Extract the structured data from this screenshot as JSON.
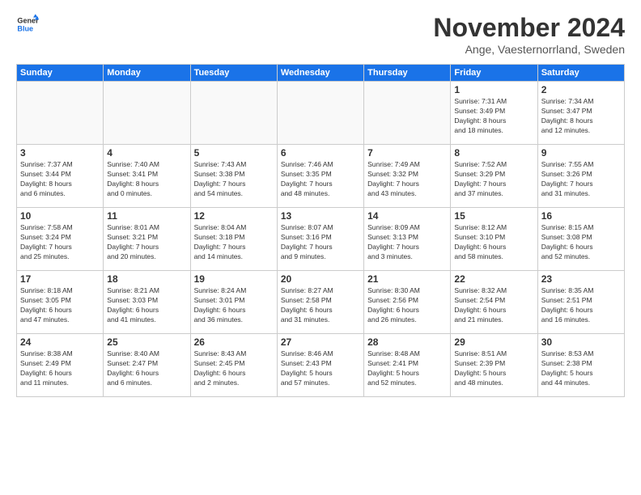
{
  "logo": {
    "text1": "General",
    "text2": "Blue"
  },
  "title": "November 2024",
  "subtitle": "Ange, Vaesternorrland, Sweden",
  "weekdays": [
    "Sunday",
    "Monday",
    "Tuesday",
    "Wednesday",
    "Thursday",
    "Friday",
    "Saturday"
  ],
  "weeks": [
    [
      {
        "day": "",
        "info": ""
      },
      {
        "day": "",
        "info": ""
      },
      {
        "day": "",
        "info": ""
      },
      {
        "day": "",
        "info": ""
      },
      {
        "day": "",
        "info": ""
      },
      {
        "day": "1",
        "info": "Sunrise: 7:31 AM\nSunset: 3:49 PM\nDaylight: 8 hours\nand 18 minutes."
      },
      {
        "day": "2",
        "info": "Sunrise: 7:34 AM\nSunset: 3:47 PM\nDaylight: 8 hours\nand 12 minutes."
      }
    ],
    [
      {
        "day": "3",
        "info": "Sunrise: 7:37 AM\nSunset: 3:44 PM\nDaylight: 8 hours\nand 6 minutes."
      },
      {
        "day": "4",
        "info": "Sunrise: 7:40 AM\nSunset: 3:41 PM\nDaylight: 8 hours\nand 0 minutes."
      },
      {
        "day": "5",
        "info": "Sunrise: 7:43 AM\nSunset: 3:38 PM\nDaylight: 7 hours\nand 54 minutes."
      },
      {
        "day": "6",
        "info": "Sunrise: 7:46 AM\nSunset: 3:35 PM\nDaylight: 7 hours\nand 48 minutes."
      },
      {
        "day": "7",
        "info": "Sunrise: 7:49 AM\nSunset: 3:32 PM\nDaylight: 7 hours\nand 43 minutes."
      },
      {
        "day": "8",
        "info": "Sunrise: 7:52 AM\nSunset: 3:29 PM\nDaylight: 7 hours\nand 37 minutes."
      },
      {
        "day": "9",
        "info": "Sunrise: 7:55 AM\nSunset: 3:26 PM\nDaylight: 7 hours\nand 31 minutes."
      }
    ],
    [
      {
        "day": "10",
        "info": "Sunrise: 7:58 AM\nSunset: 3:24 PM\nDaylight: 7 hours\nand 25 minutes."
      },
      {
        "day": "11",
        "info": "Sunrise: 8:01 AM\nSunset: 3:21 PM\nDaylight: 7 hours\nand 20 minutes."
      },
      {
        "day": "12",
        "info": "Sunrise: 8:04 AM\nSunset: 3:18 PM\nDaylight: 7 hours\nand 14 minutes."
      },
      {
        "day": "13",
        "info": "Sunrise: 8:07 AM\nSunset: 3:16 PM\nDaylight: 7 hours\nand 9 minutes."
      },
      {
        "day": "14",
        "info": "Sunrise: 8:09 AM\nSunset: 3:13 PM\nDaylight: 7 hours\nand 3 minutes."
      },
      {
        "day": "15",
        "info": "Sunrise: 8:12 AM\nSunset: 3:10 PM\nDaylight: 6 hours\nand 58 minutes."
      },
      {
        "day": "16",
        "info": "Sunrise: 8:15 AM\nSunset: 3:08 PM\nDaylight: 6 hours\nand 52 minutes."
      }
    ],
    [
      {
        "day": "17",
        "info": "Sunrise: 8:18 AM\nSunset: 3:05 PM\nDaylight: 6 hours\nand 47 minutes."
      },
      {
        "day": "18",
        "info": "Sunrise: 8:21 AM\nSunset: 3:03 PM\nDaylight: 6 hours\nand 41 minutes."
      },
      {
        "day": "19",
        "info": "Sunrise: 8:24 AM\nSunset: 3:01 PM\nDaylight: 6 hours\nand 36 minutes."
      },
      {
        "day": "20",
        "info": "Sunrise: 8:27 AM\nSunset: 2:58 PM\nDaylight: 6 hours\nand 31 minutes."
      },
      {
        "day": "21",
        "info": "Sunrise: 8:30 AM\nSunset: 2:56 PM\nDaylight: 6 hours\nand 26 minutes."
      },
      {
        "day": "22",
        "info": "Sunrise: 8:32 AM\nSunset: 2:54 PM\nDaylight: 6 hours\nand 21 minutes."
      },
      {
        "day": "23",
        "info": "Sunrise: 8:35 AM\nSunset: 2:51 PM\nDaylight: 6 hours\nand 16 minutes."
      }
    ],
    [
      {
        "day": "24",
        "info": "Sunrise: 8:38 AM\nSunset: 2:49 PM\nDaylight: 6 hours\nand 11 minutes."
      },
      {
        "day": "25",
        "info": "Sunrise: 8:40 AM\nSunset: 2:47 PM\nDaylight: 6 hours\nand 6 minutes."
      },
      {
        "day": "26",
        "info": "Sunrise: 8:43 AM\nSunset: 2:45 PM\nDaylight: 6 hours\nand 2 minutes."
      },
      {
        "day": "27",
        "info": "Sunrise: 8:46 AM\nSunset: 2:43 PM\nDaylight: 5 hours\nand 57 minutes."
      },
      {
        "day": "28",
        "info": "Sunrise: 8:48 AM\nSunset: 2:41 PM\nDaylight: 5 hours\nand 52 minutes."
      },
      {
        "day": "29",
        "info": "Sunrise: 8:51 AM\nSunset: 2:39 PM\nDaylight: 5 hours\nand 48 minutes."
      },
      {
        "day": "30",
        "info": "Sunrise: 8:53 AM\nSunset: 2:38 PM\nDaylight: 5 hours\nand 44 minutes."
      }
    ]
  ]
}
